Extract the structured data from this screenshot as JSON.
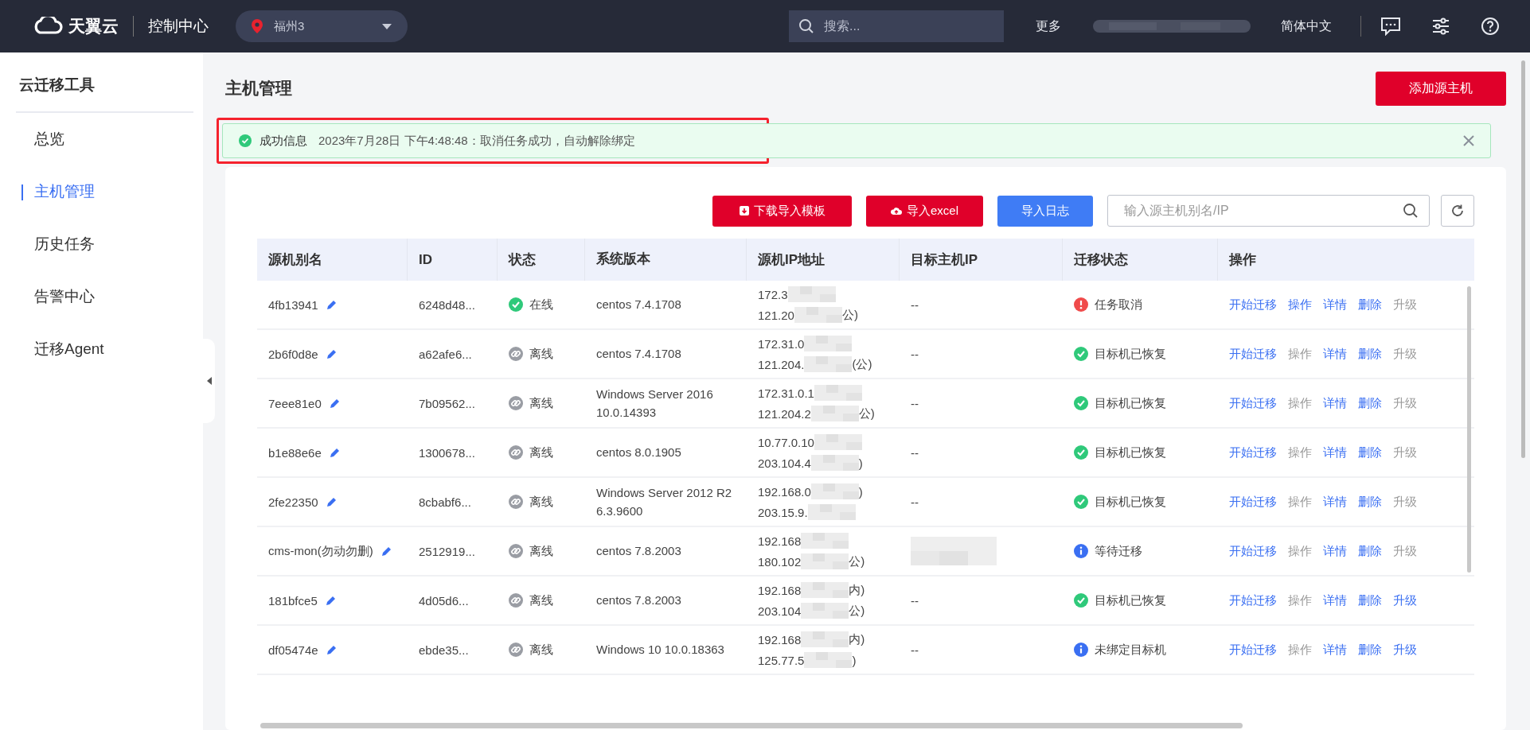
{
  "topbar": {
    "brand": "天翼云",
    "console": "控制中心",
    "region": "福州3",
    "search": {
      "placeholder": "搜索..."
    },
    "more": "更多",
    "language": "简体中文"
  },
  "sidebar": {
    "title": "云迁移工具",
    "items": [
      {
        "label": "总览",
        "selected": false
      },
      {
        "label": "主机管理",
        "selected": true
      },
      {
        "label": "历史任务",
        "selected": false
      },
      {
        "label": "告警中心",
        "selected": false
      },
      {
        "label": "迁移Agent",
        "selected": false
      }
    ]
  },
  "page": {
    "title": "主机管理",
    "add_button": "添加源主机"
  },
  "alert": {
    "title": "成功信息",
    "message": "2023年7月28日 下午4:48:48：取消任务成功，自动解除绑定",
    "highlighted": true
  },
  "toolbar": {
    "buttons": [
      {
        "label": "下载导入模板",
        "kind": "download"
      },
      {
        "label": "导入excel",
        "kind": "upload"
      },
      {
        "label": "导入日志",
        "kind": "log"
      }
    ],
    "search": {
      "placeholder": "输入源主机别名/IP"
    }
  },
  "table": {
    "columns": [
      "源机别名",
      "ID",
      "状态",
      "系统版本",
      "源机IP地址",
      "目标主机IP",
      "迁移状态",
      "操作"
    ],
    "rows": [
      {
        "alias": "4fb13941",
        "id": "6248d48...",
        "status": {
          "label": "在线",
          "kind": "online"
        },
        "os": "centos 7.4.1708",
        "ip": [
          {
            "prefix": "172.3"
          },
          {
            "prefix": "121.20",
            "suffix": "公)"
          }
        ],
        "target_ip": "--",
        "target_hidden": false,
        "migration": {
          "label": "任务取消",
          "kind": "error"
        },
        "actions": [
          {
            "label": "开始迁移",
            "disabled": false
          },
          {
            "label": "操作",
            "disabled": false
          },
          {
            "label": "详情",
            "disabled": false
          },
          {
            "label": "删除",
            "disabled": false
          },
          {
            "label": "升级",
            "disabled": true
          }
        ]
      },
      {
        "alias": "2b6f0d8e",
        "id": "a62afe6...",
        "status": {
          "label": "离线",
          "kind": "offline"
        },
        "os": "centos 7.4.1708",
        "ip": [
          {
            "prefix": "172.31.0"
          },
          {
            "prefix": "121.204.",
            "suffix": "(公)"
          }
        ],
        "target_ip": "--",
        "target_hidden": false,
        "migration": {
          "label": "目标机已恢复",
          "kind": "success"
        },
        "actions": [
          {
            "label": "开始迁移",
            "disabled": false
          },
          {
            "label": "操作",
            "disabled": true
          },
          {
            "label": "详情",
            "disabled": false
          },
          {
            "label": "删除",
            "disabled": false
          },
          {
            "label": "升级",
            "disabled": true
          }
        ]
      },
      {
        "alias": "7eee81e0",
        "id": "7b09562...",
        "status": {
          "label": "离线",
          "kind": "offline"
        },
        "os": "Windows Server 2016 10.0.14393",
        "ip": [
          {
            "prefix": "172.31.0.1"
          },
          {
            "prefix": "121.204.2",
            "suffix": "公)"
          }
        ],
        "target_ip": "--",
        "target_hidden": false,
        "migration": {
          "label": "目标机已恢复",
          "kind": "success"
        },
        "actions": [
          {
            "label": "开始迁移",
            "disabled": false
          },
          {
            "label": "操作",
            "disabled": true
          },
          {
            "label": "详情",
            "disabled": false
          },
          {
            "label": "删除",
            "disabled": false
          },
          {
            "label": "升级",
            "disabled": true
          }
        ]
      },
      {
        "alias": "b1e88e6e",
        "id": "1300678...",
        "status": {
          "label": "离线",
          "kind": "offline"
        },
        "os": "centos 8.0.1905",
        "ip": [
          {
            "prefix": "10.77.0.10"
          },
          {
            "prefix": "203.104.4",
            "suffix": ")"
          }
        ],
        "target_ip": "--",
        "target_hidden": false,
        "migration": {
          "label": "目标机已恢复",
          "kind": "success"
        },
        "actions": [
          {
            "label": "开始迁移",
            "disabled": false
          },
          {
            "label": "操作",
            "disabled": true
          },
          {
            "label": "详情",
            "disabled": false
          },
          {
            "label": "删除",
            "disabled": false
          },
          {
            "label": "升级",
            "disabled": true
          }
        ]
      },
      {
        "alias": "2fe22350",
        "id": "8cbabf6...",
        "status": {
          "label": "离线",
          "kind": "offline"
        },
        "os": "Windows Server 2012 R2 6.3.9600",
        "ip": [
          {
            "prefix": "192.168.0",
            "suffix": ")"
          },
          {
            "prefix": "203.15.9."
          }
        ],
        "target_ip": "--",
        "target_hidden": false,
        "migration": {
          "label": "目标机已恢复",
          "kind": "success"
        },
        "actions": [
          {
            "label": "开始迁移",
            "disabled": false
          },
          {
            "label": "操作",
            "disabled": true
          },
          {
            "label": "详情",
            "disabled": false
          },
          {
            "label": "删除",
            "disabled": false
          },
          {
            "label": "升级",
            "disabled": true
          }
        ]
      },
      {
        "alias": "cms-mon(勿动勿删)",
        "id": "2512919...",
        "status": {
          "label": "离线",
          "kind": "offline"
        },
        "os": "centos 7.8.2003",
        "ip": [
          {
            "prefix": "192.168"
          },
          {
            "prefix": "180.102",
            "suffix": "公)"
          }
        ],
        "target_hidden": true,
        "migration": {
          "label": "等待迁移",
          "kind": "info"
        },
        "actions": [
          {
            "label": "开始迁移",
            "disabled": false
          },
          {
            "label": "操作",
            "disabled": true
          },
          {
            "label": "详情",
            "disabled": false
          },
          {
            "label": "删除",
            "disabled": false
          },
          {
            "label": "升级",
            "disabled": true
          }
        ]
      },
      {
        "alias": "181bfce5",
        "id": "4d05d6...",
        "status": {
          "label": "离线",
          "kind": "offline"
        },
        "os": "centos 7.8.2003",
        "ip": [
          {
            "prefix": "192.168",
            "suffix": "内)"
          },
          {
            "prefix": "203.104",
            "suffix": "公)"
          }
        ],
        "target_ip": "--",
        "target_hidden": false,
        "migration": {
          "label": "目标机已恢复",
          "kind": "success"
        },
        "actions": [
          {
            "label": "开始迁移",
            "disabled": false
          },
          {
            "label": "操作",
            "disabled": true
          },
          {
            "label": "详情",
            "disabled": false
          },
          {
            "label": "删除",
            "disabled": false
          },
          {
            "label": "升级",
            "disabled": false
          }
        ]
      },
      {
        "alias": "df05474e",
        "id": "ebde35...",
        "status": {
          "label": "离线",
          "kind": "offline"
        },
        "os": "Windows 10 10.0.18363",
        "ip": [
          {
            "prefix": "192.168",
            "suffix": "内)"
          },
          {
            "prefix": "125.77.5",
            "suffix": ")"
          }
        ],
        "target_ip": "--",
        "target_hidden": false,
        "migration": {
          "label": "未绑定目标机",
          "kind": "info"
        },
        "actions": [
          {
            "label": "开始迁移",
            "disabled": false
          },
          {
            "label": "操作",
            "disabled": true
          },
          {
            "label": "详情",
            "disabled": false
          },
          {
            "label": "删除",
            "disabled": false
          },
          {
            "label": "升级",
            "disabled": false
          }
        ]
      }
    ]
  }
}
